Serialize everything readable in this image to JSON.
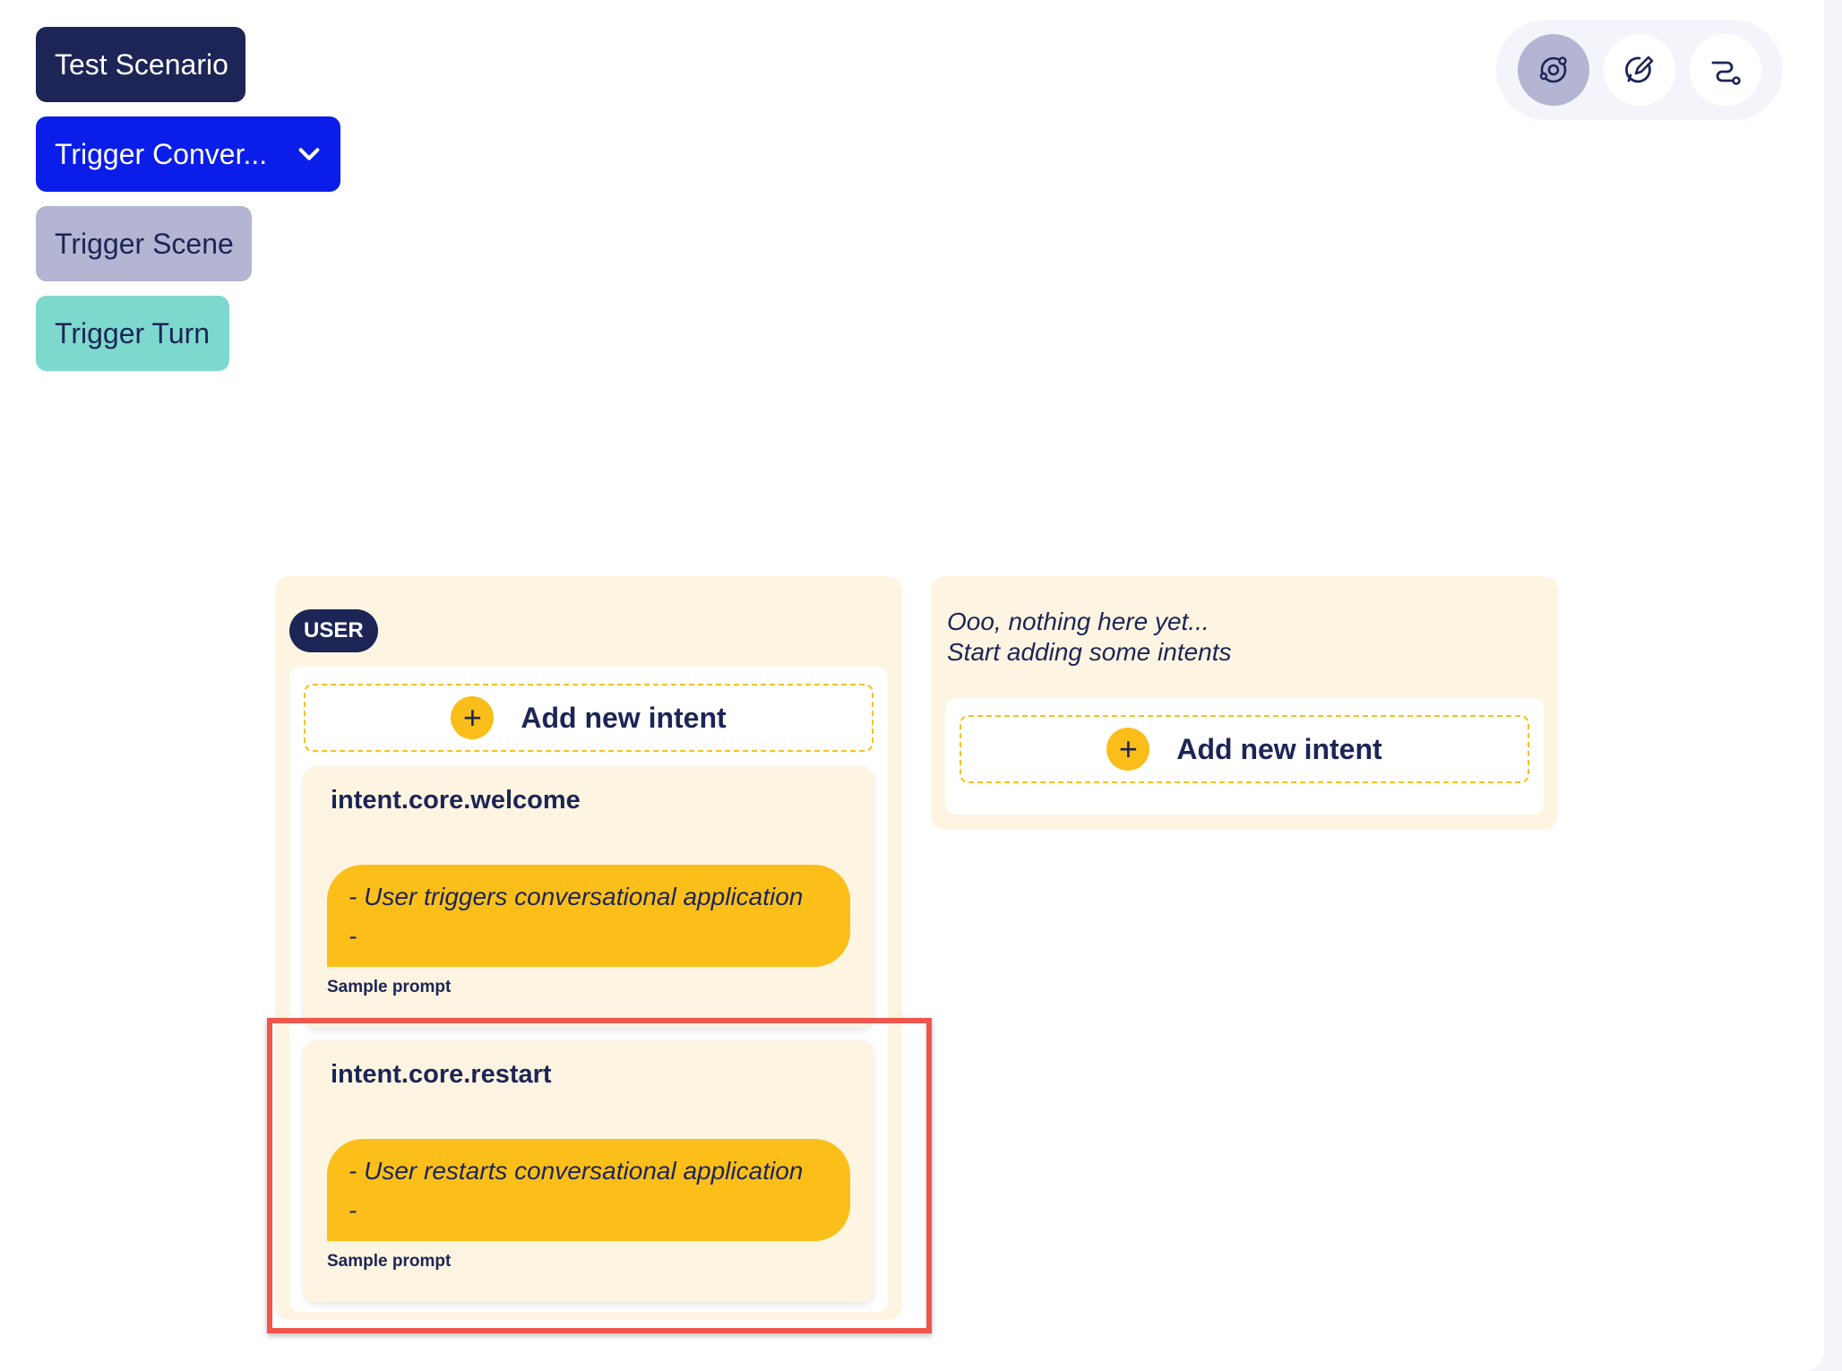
{
  "breadcrumbs": {
    "scenario": "Test Scenario",
    "conversation": "Trigger Conver...",
    "scene": "Trigger Scene",
    "turn": "Trigger Turn"
  },
  "view_toggle": {
    "items": [
      {
        "icon": "orbit-icon",
        "active": true
      },
      {
        "icon": "chat-edit-icon",
        "active": false
      },
      {
        "icon": "flow-path-icon",
        "active": false
      }
    ]
  },
  "user_column": {
    "badge": "USER",
    "add_intent_label": "Add new intent",
    "intents": [
      {
        "name": "intent.core.welcome",
        "prompt_lines": [
          "- User triggers conversational application",
          "-"
        ],
        "caption": "Sample prompt"
      },
      {
        "name": "intent.core.restart",
        "prompt_lines": [
          "- User restarts conversational application",
          "-"
        ],
        "caption": "Sample prompt"
      }
    ]
  },
  "empty_column": {
    "line1": "Ooo, nothing here yet...",
    "line2": "Start adding some intents",
    "add_intent_label": "Add new intent"
  },
  "colors": {
    "navy": "#1c2556",
    "blue": "#0a1de9",
    "lavender": "#b3b5d2",
    "teal": "#7dd9ce",
    "cream": "#fdf5e1",
    "yellow": "#fcbf1a",
    "highlight": "#f0554b"
  }
}
